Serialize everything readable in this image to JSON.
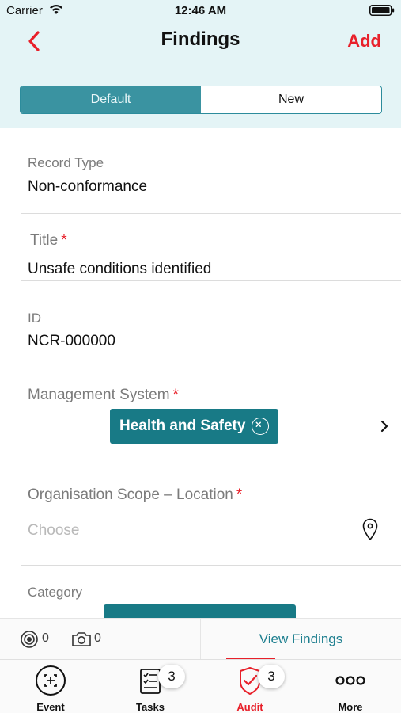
{
  "status_bar": {
    "carrier": "Carrier",
    "time": "12:46 AM"
  },
  "nav": {
    "title": "Findings",
    "add_label": "Add"
  },
  "segments": [
    {
      "label": "Default",
      "active": true
    },
    {
      "label": "New",
      "active": false
    }
  ],
  "fields": {
    "record_type": {
      "label": "Record Type",
      "value": "Non-conformance"
    },
    "title": {
      "label": "Title",
      "required": "*",
      "value": "Unsafe conditions identified"
    },
    "id": {
      "label": "ID",
      "value": "NCR-000000"
    },
    "management_system": {
      "label": "Management System",
      "required": "*",
      "chip": "Health and Safety"
    },
    "organisation_scope": {
      "label": "Organisation Scope – Location",
      "required": "*",
      "placeholder": "Choose"
    },
    "category": {
      "label": "Category"
    }
  },
  "action_row": {
    "record_count": "0",
    "photo_count": "0",
    "view_findings_label": "View Findings"
  },
  "tabs": [
    {
      "label": "Event",
      "icon": "event-scan-icon",
      "badge": null,
      "active": false
    },
    {
      "label": "Tasks",
      "icon": "tasks-checklist-icon",
      "badge": "3",
      "active": false
    },
    {
      "label": "Audit",
      "icon": "audit-shield-check-icon",
      "badge": "3",
      "active": true
    },
    {
      "label": "More",
      "icon": "more-dots-icon",
      "badge": null,
      "active": false
    }
  ],
  "colors": {
    "accent_red": "#e8202a",
    "teal": "#187a86",
    "header_bg": "#e4f4f6"
  }
}
